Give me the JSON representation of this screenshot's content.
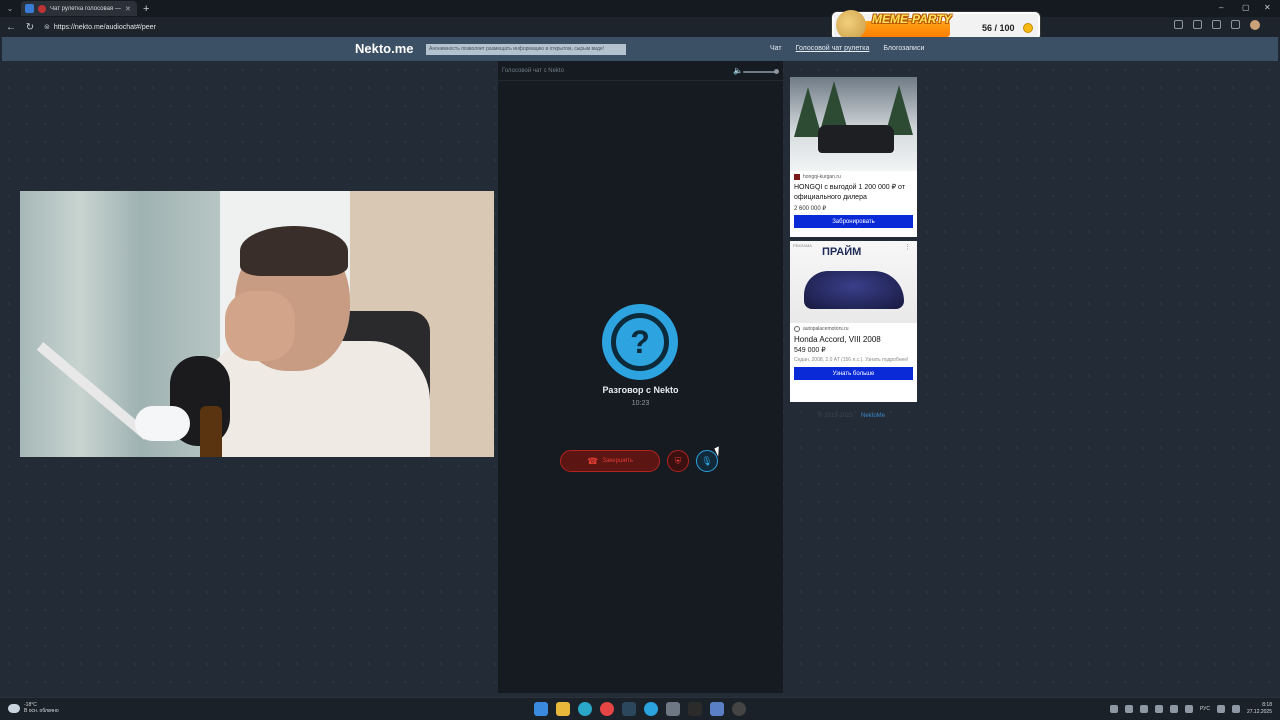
{
  "browser": {
    "tab_title": "Чат рулетка голосовая — N",
    "tab_close": "✕",
    "new_tab": "+",
    "url": "https://nekto.me/audiochat#/peer",
    "win_min": "–",
    "win_max": "▢",
    "win_close": "✕"
  },
  "overlay": {
    "brand": "MEME-PARTY",
    "score": "56 / 100"
  },
  "site": {
    "logo": "Nekto.me",
    "notice": "Анонимность позволяет размещать информацию в открытом, сырым виде!",
    "nav": {
      "chat": "Чат",
      "voice": "Голосовой чат рулетка",
      "blog": "Блогозаписи"
    }
  },
  "chat": {
    "panel_title": "Голосовой чат с Nekto",
    "avatar_symbol": "?",
    "peer_label": "Разговор с Nekto",
    "timer": "10:23",
    "end_label": "Завершить",
    "end_icon": "☎",
    "report_icon": "⛨",
    "mic_icon": "🎙",
    "volume_icon": "🔈"
  },
  "ads": [
    {
      "source": "hongqi-kurgan.ru",
      "title": "HONGQI с выгодой 1 200 000 ₽ от официального дилера",
      "price": "2 600 000 ₽",
      "cta": "Забронировать"
    },
    {
      "label": "РЕКЛАМА",
      "brand": "ПРАЙМ",
      "source": "autopalacemotors.ru",
      "title": "Honda Accord, VIII 2008",
      "price": "549 000 ₽",
      "desc": "Седан, 2008, 2.0 AT (156 л.с.). Узнать подробнее!",
      "cta": "Узнать больше"
    }
  ],
  "footer": {
    "copyright": "© 2013-2025",
    "link": "NektoMe"
  },
  "taskbar": {
    "temp": "-18°C",
    "weather": "В осн. облачно",
    "lang": "РУС",
    "time": "8:18",
    "date": "27.12.2025"
  }
}
